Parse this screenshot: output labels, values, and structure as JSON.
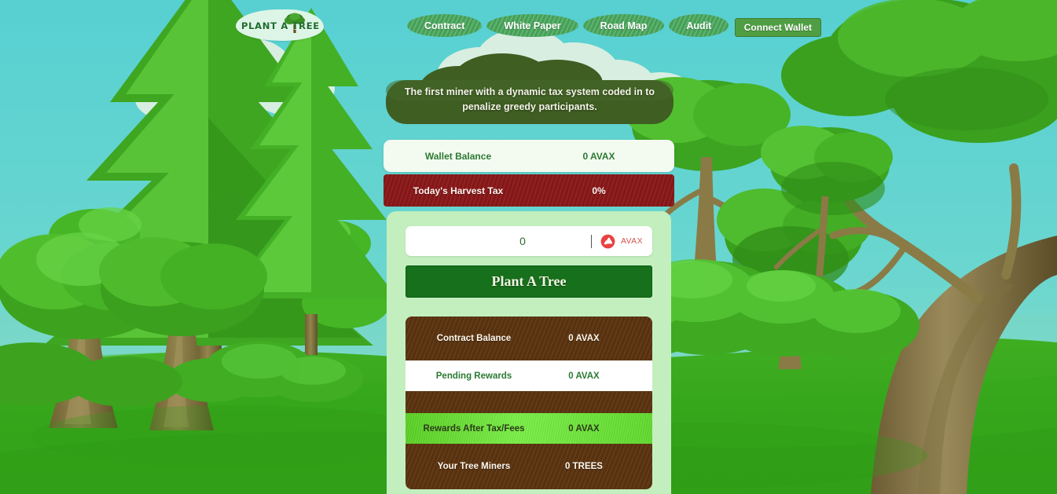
{
  "app": {
    "title": "Plant A Tree"
  },
  "nav": {
    "logo_text": "PLANT A TREE",
    "links": [
      {
        "label": "Contract"
      },
      {
        "label": "White Paper"
      },
      {
        "label": "Road Map"
      },
      {
        "label": "Audit"
      }
    ],
    "connect_wallet_label": "Connect Wallet"
  },
  "banner": {
    "text": "The first miner with a dynamic tax system coded in to penalize greedy participants."
  },
  "summary": {
    "wallet": {
      "label": "Wallet Balance",
      "value": "0  AVAX"
    },
    "tax": {
      "label": "Today's Harvest Tax",
      "value": "0%"
    }
  },
  "form": {
    "amount_value": "0",
    "amount_placeholder": "0",
    "currency_label": "AVAX",
    "currency_icon": "avax-icon",
    "submit_label": "Plant A Tree"
  },
  "stats": [
    {
      "label": "Contract Balance",
      "value": "0 AVAX",
      "style": "dark"
    },
    {
      "label": "Pending Rewards",
      "value": "0 AVAX",
      "style": "white"
    },
    {
      "label": "Rewards After Tax/Fees",
      "value": "0 AVAX",
      "style": "green"
    },
    {
      "label": "Your Tree Miners",
      "value": "0 TREES",
      "style": "dark"
    }
  ],
  "colors": {
    "sky": "#5fd3d3",
    "nav_pill": "#49a85c",
    "connect_button": "#4f9e43",
    "tax_bar": "#8a1718",
    "panel": "#c3efbf",
    "plant_button": "#17701b",
    "brown_card": "#5c3410",
    "highlight_green": "#6fe63a",
    "avax_red": "#e84142"
  }
}
